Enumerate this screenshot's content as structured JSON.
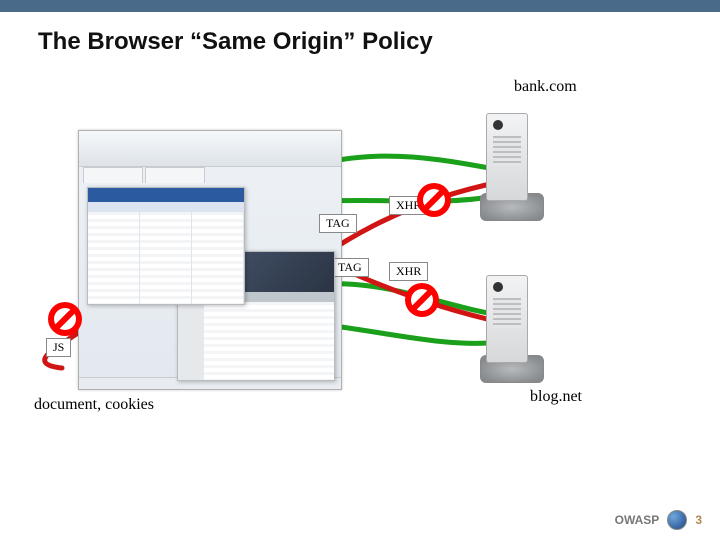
{
  "title": "The Browser “Same Origin” Policy",
  "servers": {
    "top": "bank.com",
    "bottom": "blog.net"
  },
  "document_label": "document, cookies",
  "tags": {
    "js": "JS",
    "tag1": "TAG",
    "tag2": "TAG",
    "xhr1": "XHR",
    "xhr2": "XHR"
  },
  "footer": {
    "org": "OWASP",
    "page": "3"
  }
}
